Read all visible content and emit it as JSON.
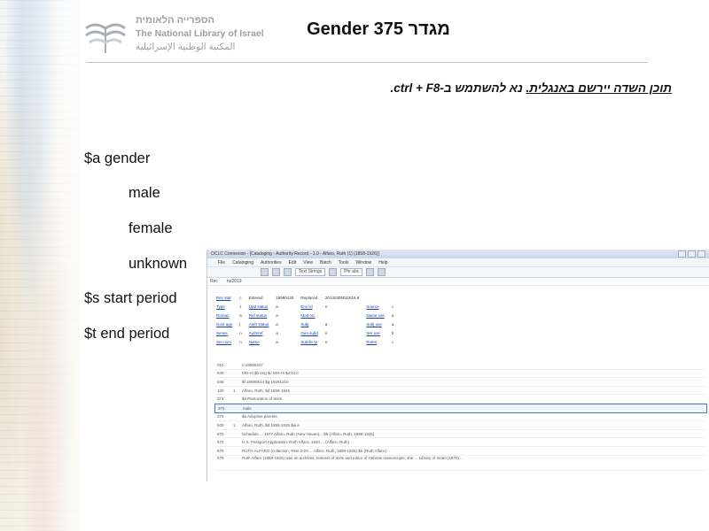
{
  "logo": {
    "hebrew": "הספרייה הלאומית",
    "english": "The National Library of Israel",
    "arabic": "المكتبة الوطنية الإسرائيلية"
  },
  "title": "Gender 375 מגדר",
  "note": {
    "underlined": "תוכן השדה יירשם באנגלית.",
    "rest": " נא להשתמש ב-ctrl + F8."
  },
  "spec": {
    "line1": "$a gender",
    "line2": "male",
    "line3": "female",
    "line4": "unknown",
    "line5": "$s start period",
    "line6": "$t end period"
  },
  "app": {
    "window_title": "OCLC Connexion - [Cataloging - Authority Record - 1.0 - Alfaro, Ruth (1) (1858-1926)]",
    "menu": [
      "File",
      "Cataloging",
      "Authorities",
      "Edit",
      "View",
      "Batch",
      "Tools",
      "Window",
      "Help"
    ],
    "toolbar_select": "Text Strings",
    "toolbar_select2": "Phr abc",
    "rec_label": "Rec",
    "rec_id": "no2019",
    "fixed_fields": [
      [
        "Rec stat",
        "c",
        "Entered",
        "19990426",
        "Replaced",
        "20140305011616.8"
      ],
      [
        "Type",
        "z",
        "Upd status",
        "a",
        "Enc lvl",
        "n",
        "Source",
        "c"
      ],
      [
        "Roman",
        "a",
        "Ref status",
        "a",
        "Mod rec",
        "",
        "Name use",
        "a"
      ],
      [
        "Govt agn",
        "|",
        "Auth status",
        "a",
        "Subj",
        "a",
        "Subj use",
        "a"
      ],
      [
        "Series",
        "n",
        "Auth/ref",
        "a",
        "Geo subd",
        "n",
        "Ser use",
        "b"
      ],
      [
        "Ser num",
        "n",
        "Name",
        "a",
        "Subdiv tp",
        "n",
        "Rules",
        "c"
      ]
    ],
    "fields": [
      [
        "010",
        "",
        "n 19990427"
      ],
      [
        "040",
        "",
        "MH-Hi $b eng $c MH-Hi $d DLC"
      ],
      [
        "046",
        "",
        "$f 18580514 $g 19261210"
      ],
      [
        "100",
        "1",
        "Alfaro, Ruth, $d 1858-1926"
      ],
      [
        "374",
        "",
        "$a Restoration of texts"
      ],
      [
        "375",
        "",
        "male"
      ],
      [
        "376",
        "",
        "$a Adoptive parents"
      ],
      [
        "500",
        "1",
        "Alfaro, Ruth, $d 1858-1926 $w a"
      ],
      [
        "670",
        "",
        "Schedule ... 1877 Alfaro, Ruth (New Haven)... $b (Alfaro, Ruth, 1858-1926)"
      ],
      [
        "670",
        "",
        "U.S. Passport Application, Ruth Alfaro, 1920 ... (Alfaro, Ruth)"
      ],
      [
        "670",
        "",
        "RUTH ALFARO (collection, Reel 1-23 ... Alfaro, Ruth, 1858-1926) $b (Ruth Alfaro)"
      ],
      [
        "678",
        "",
        "Ruth Alfaro (1858-1926) was an archivist, restorer of texts and editor of Hebrew manuscripts, she ... Library of Israel (1870) ..."
      ]
    ]
  }
}
